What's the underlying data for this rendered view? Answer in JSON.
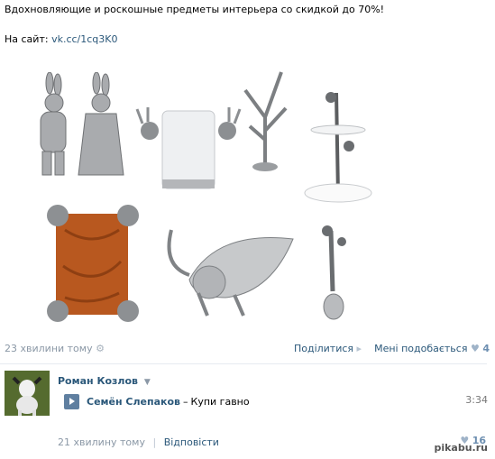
{
  "post": {
    "text": "Вдохновляющие и роскошные предметы интерьера со скидкой до 70%!",
    "link_prefix": "На сайт:",
    "link_text": "vk.cc/1cq3K0"
  },
  "footer": {
    "time": "23 хвилини тому",
    "share": "Поділитися",
    "like_label": "Мені подобається",
    "like_count": "4"
  },
  "comment": {
    "author": "Роман Козлов",
    "audio_artist": "Семён Слепаков",
    "audio_separator": "–",
    "audio_title": "Купи гавно",
    "duration": "3:34",
    "time": "21 хвилину тому",
    "reply": "Відповісти",
    "like_count": "16"
  },
  "watermark": "pikabu.ru",
  "colors": {
    "link": "#2b587a",
    "muted": "#8b98a6",
    "play": "#5f7fa0",
    "like": "#6c8eb0"
  }
}
